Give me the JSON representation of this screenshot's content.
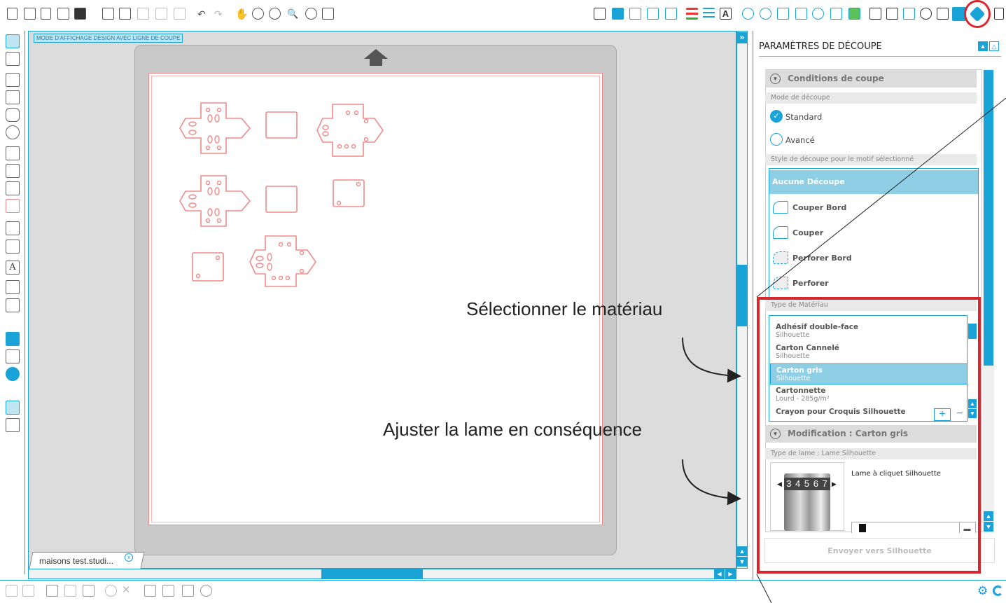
{
  "view_mode_label": "MODE D'AFFICHAGE DESIGN AVEC LIGNE DE COUPE",
  "document_tab": {
    "name": "maisons test.studi...",
    "close": "x"
  },
  "collapse_glyph": "»",
  "panel": {
    "title": "PARAMÈTRES DE DÉCOUPE",
    "conditions_header": "Conditions de coupe",
    "cut_mode_label": "Mode de découpe",
    "mode_standard": "Standard",
    "mode_advanced": "Avancé",
    "style_label": "Style de découpe pour le motif sélectionné",
    "cut_styles": [
      "Aucune Découpe",
      "Couper Bord",
      "Couper",
      "Perforer Bord",
      "Perforer"
    ],
    "material_type_label": "Type de Matériau",
    "materials": [
      {
        "name": "Adhésif double-face",
        "sub": "Silhouette"
      },
      {
        "name": "Carton Cannelé",
        "sub": "Silhouette"
      },
      {
        "name": "Carton gris",
        "sub": "Silhouette"
      },
      {
        "name": "Cartonnette",
        "sub": "Lourd - 285g/m²"
      },
      {
        "name": "Crayon pour Croquis Silhouette",
        "sub": ""
      }
    ],
    "selected_material": "Carton gris",
    "add_label": "+",
    "remove_label": "−",
    "modification_header": "Modification : Carton gris",
    "blade_type_label": "Type de lame : Lame Silhouette",
    "blade_name": "Lame à cliquet Silhouette",
    "blade_numbers": "3 4 5 6 7",
    "send_button": "Envoyer vers Silhouette"
  },
  "annotations": {
    "select_material": "Sélectionner le matériau",
    "adjust_blade": "Ajuster la lame en conséquence"
  },
  "colors": {
    "accent": "#1aa3d6",
    "highlight": "#d9262c",
    "cut_line": "#ef8a8a",
    "mat": "#d4d4d4"
  },
  "icons": {
    "top_toolbar": [
      "new-icon",
      "open-icon",
      "library-icon",
      "save-icon",
      "save-as-icon",
      "print-icon",
      "print-cut-icon",
      "copy-icon",
      "paste-icon",
      "cut-icon",
      "undo-icon",
      "redo-icon",
      "pan-icon",
      "zoom-in-icon",
      "zoom-out-icon",
      "zoom-select-icon",
      "zoom-drag-icon",
      "fit-page-icon"
    ],
    "right_toolbar": [
      "fill-icon",
      "page-icon",
      "grid-icon",
      "registration-icon",
      "cut-settings-icon",
      "line-color-icon",
      "line-style-icon",
      "text-icon",
      "transform-icon",
      "replicate-icon",
      "offset-icon",
      "trace-icon",
      "pixscan-icon",
      "store-icon",
      "cut-tab-icon"
    ]
  }
}
